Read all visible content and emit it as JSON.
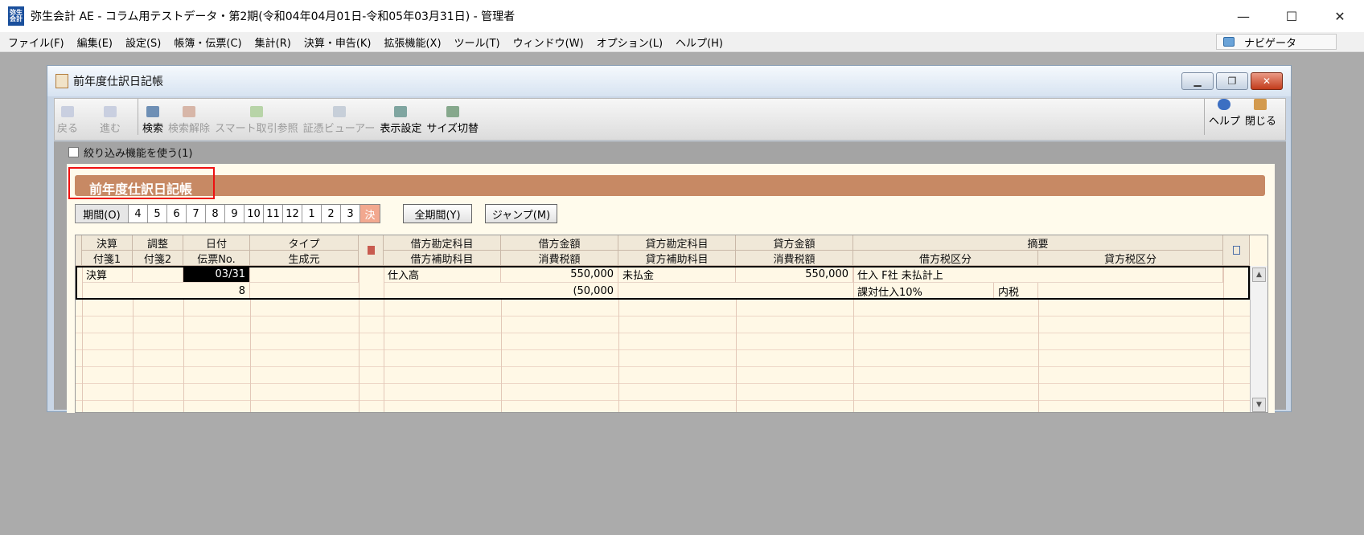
{
  "app": {
    "title": "弥生会計 AE - コラム用テストデータ・第2期(令和04年04月01日-令和05年03月31日) - 管理者",
    "icon_top": "弥生",
    "icon_bottom": "会計"
  },
  "menu": [
    "ファイル(F)",
    "編集(E)",
    "設定(S)",
    "帳簿・伝票(C)",
    "集計(R)",
    "決算・申告(K)",
    "拡張機能(X)",
    "ツール(T)",
    "ウィンドウ(W)",
    "オプション(L)",
    "ヘルプ(H)"
  ],
  "navi": {
    "label": "ナビゲータ"
  },
  "window": {
    "title": "前年度仕訳日記帳"
  },
  "toolbar": {
    "back": "戻る",
    "forward": "進む",
    "search": "検索",
    "clear": "検索解除",
    "smart": "スマート取引参照",
    "evidence": "証憑ビューアー",
    "display": "表示設定",
    "size": "サイズ切替",
    "help": "ヘルプ",
    "close": "閉じる"
  },
  "filter": {
    "label": "絞り込み機能を使う(1)"
  },
  "panel": {
    "title": "前年度仕訳日記帳"
  },
  "periods": {
    "label": "期間(O)",
    "months": [
      "4",
      "5",
      "6",
      "7",
      "8",
      "9",
      "10",
      "11",
      "12",
      "1",
      "2",
      "3"
    ],
    "closing": "決",
    "all": "全期間(Y)",
    "jump": "ジャンプ(M)"
  },
  "headers": {
    "row1": [
      "決算",
      "調整",
      "日付",
      "タイプ",
      "借方勘定科目",
      "借方金額",
      "貸方勘定科目",
      "貸方金額",
      "摘要"
    ],
    "row2": [
      "付箋1",
      "付箋2",
      "伝票No.",
      "生成元",
      "借方補助科目",
      "消費税額",
      "貸方補助科目",
      "消費税額",
      "借方税区分",
      "貸方税区分"
    ]
  },
  "rows": [
    {
      "kessan": "決算",
      "date": "03/31",
      "debit_account": "仕入高",
      "debit_amount": "550,000",
      "credit_account": "未払金",
      "credit_amount": "550,000",
      "summary": "仕入 F社 未払計上"
    },
    {
      "voucher": "8",
      "debit_tax": "(50,000",
      "debit_tax_class": "課対仕入10%",
      "tax_type": "内税"
    }
  ]
}
